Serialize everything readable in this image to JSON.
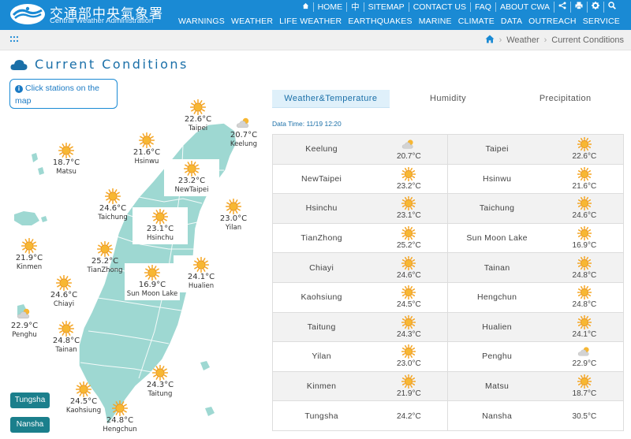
{
  "header": {
    "brand_zh": "交通部中央氣象署",
    "brand_en": "Central Weather Administration",
    "topnav": [
      "HOME",
      "中",
      "SITEMAP",
      "CONTACT US",
      "FAQ",
      "ABOUT CWA"
    ],
    "mainnav": [
      "WARNINGS",
      "WEATHER",
      "LIFE WEATHER",
      "EARTHQUAKES",
      "MARINE",
      "CLIMATE",
      "DATA",
      "OUTREACH",
      "SERVICE"
    ]
  },
  "breadcrumb": {
    "items": [
      "Weather",
      "Current Conditions"
    ]
  },
  "page": {
    "title": "Current Conditions",
    "hint": "Click stations on the map"
  },
  "tabs": [
    "Weather&Temperature",
    "Humidity",
    "Precipitation"
  ],
  "data_time": "Data Time: 11/19 12:20",
  "map_stations": [
    {
      "name": "Taipei",
      "temp": "22.6°C",
      "icon": "sun"
    },
    {
      "name": "Keelung",
      "temp": "20.7°C",
      "icon": "cloudy"
    },
    {
      "name": "Hsinwu",
      "temp": "21.6°C",
      "icon": "sun"
    },
    {
      "name": "Matsu",
      "temp": "18.7°C",
      "icon": "sun"
    },
    {
      "name": "NewTaipei",
      "temp": "23.2°C",
      "icon": "sun"
    },
    {
      "name": "Taichung",
      "temp": "24.6°C",
      "icon": "sun"
    },
    {
      "name": "Yilan",
      "temp": "23.0°C",
      "icon": "sun"
    },
    {
      "name": "Hsinchu",
      "temp": "23.1°C",
      "icon": "sun"
    },
    {
      "name": "Kinmen",
      "temp": "21.9°C",
      "icon": "sun"
    },
    {
      "name": "TianZhong",
      "temp": "25.2°C",
      "icon": "sun"
    },
    {
      "name": "Hualien",
      "temp": "24.1°C",
      "icon": "sun"
    },
    {
      "name": "Sun Moon Lake",
      "temp": "16.9°C",
      "icon": "sun"
    },
    {
      "name": "Chiayi",
      "temp": "24.6°C",
      "icon": "sun"
    },
    {
      "name": "Penghu",
      "temp": "22.9°C",
      "icon": "cloudy"
    },
    {
      "name": "Tainan",
      "temp": "24.8°C",
      "icon": "sun"
    },
    {
      "name": "Taitung",
      "temp": "24.3°C",
      "icon": "sun"
    },
    {
      "name": "Kaohsiung",
      "temp": "24.5°C",
      "icon": "sun"
    },
    {
      "name": "Hengchun",
      "temp": "24.8°C",
      "icon": "sun"
    }
  ],
  "island_buttons": [
    "Tungsha",
    "Nansha"
  ],
  "table": [
    [
      {
        "name": "Keelung",
        "temp": "20.7°C",
        "icon": "cloudy"
      },
      {
        "name": "Taipei",
        "temp": "22.6°C",
        "icon": "sun"
      }
    ],
    [
      {
        "name": "NewTaipei",
        "temp": "23.2°C",
        "icon": "sun"
      },
      {
        "name": "Hsinwu",
        "temp": "21.6°C",
        "icon": "sun"
      }
    ],
    [
      {
        "name": "Hsinchu",
        "temp": "23.1°C",
        "icon": "sun"
      },
      {
        "name": "Taichung",
        "temp": "24.6°C",
        "icon": "sun"
      }
    ],
    [
      {
        "name": "TianZhong",
        "temp": "25.2°C",
        "icon": "sun"
      },
      {
        "name": "Sun Moon Lake",
        "temp": "16.9°C",
        "icon": "sun"
      }
    ],
    [
      {
        "name": "Chiayi",
        "temp": "24.6°C",
        "icon": "sun"
      },
      {
        "name": "Tainan",
        "temp": "24.8°C",
        "icon": "sun"
      }
    ],
    [
      {
        "name": "Kaohsiung",
        "temp": "24.5°C",
        "icon": "sun"
      },
      {
        "name": "Hengchun",
        "temp": "24.8°C",
        "icon": "sun"
      }
    ],
    [
      {
        "name": "Taitung",
        "temp": "24.3°C",
        "icon": "sun"
      },
      {
        "name": "Hualien",
        "temp": "24.1°C",
        "icon": "sun"
      }
    ],
    [
      {
        "name": "Yilan",
        "temp": "23.0°C",
        "icon": "sun"
      },
      {
        "name": "Penghu",
        "temp": "22.9°C",
        "icon": "cloudy"
      }
    ],
    [
      {
        "name": "Kinmen",
        "temp": "21.9°C",
        "icon": "sun"
      },
      {
        "name": "Matsu",
        "temp": "18.7°C",
        "icon": "sun"
      }
    ],
    [
      {
        "name": "Tungsha",
        "temp": "24.2°C",
        "icon": ""
      },
      {
        "name": "Nansha",
        "temp": "30.5°C",
        "icon": ""
      }
    ]
  ],
  "colors": {
    "header_blue": "#1a8ad4",
    "title_blue": "#1a6fa8",
    "map_teal": "#9ed8d2",
    "island_button": "#1b7f8c",
    "sun_orange": "#f5a623"
  }
}
